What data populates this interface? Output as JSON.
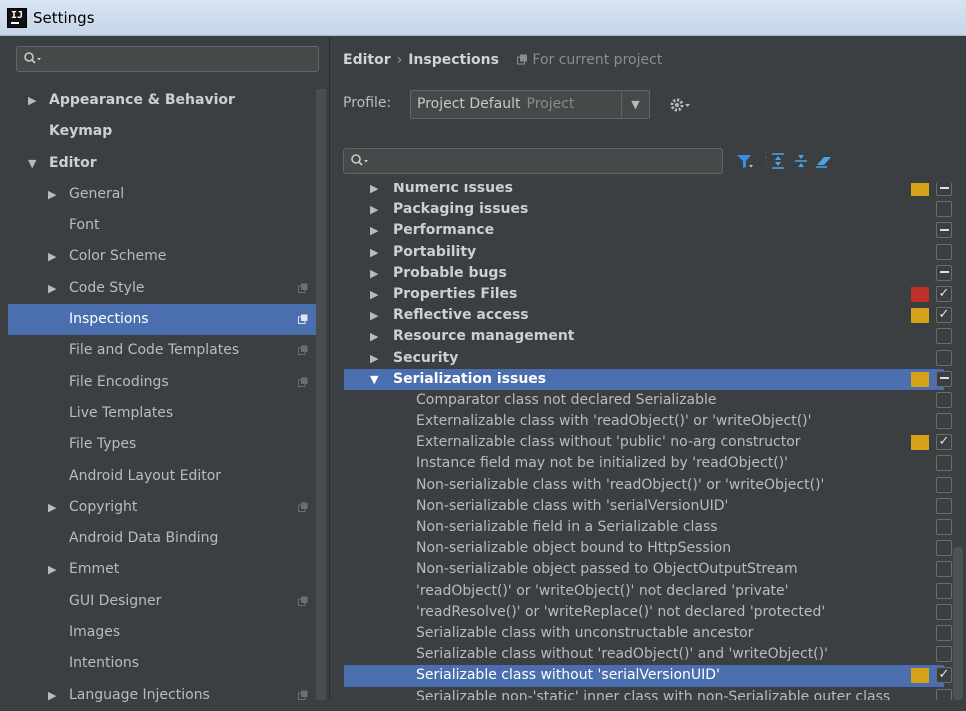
{
  "window": {
    "title": "Settings",
    "app_icon_text": "IJ"
  },
  "left_tree": [
    {
      "label": "Appearance & Behavior",
      "level": 0,
      "arrow": "right",
      "bold": true
    },
    {
      "label": "Keymap",
      "level": 0,
      "arrow": "",
      "bold": true
    },
    {
      "label": "Editor",
      "level": 0,
      "arrow": "down",
      "bold": true
    },
    {
      "label": "General",
      "level": 1,
      "arrow": "right"
    },
    {
      "label": "Font",
      "level": 1,
      "arrow": ""
    },
    {
      "label": "Color Scheme",
      "level": 1,
      "arrow": "right"
    },
    {
      "label": "Code Style",
      "level": 1,
      "arrow": "right",
      "copy": true
    },
    {
      "label": "Inspections",
      "level": 1,
      "arrow": "",
      "copy": true,
      "selected": true
    },
    {
      "label": "File and Code Templates",
      "level": 1,
      "arrow": "",
      "copy": true
    },
    {
      "label": "File Encodings",
      "level": 1,
      "arrow": "",
      "copy": true
    },
    {
      "label": "Live Templates",
      "level": 1,
      "arrow": ""
    },
    {
      "label": "File Types",
      "level": 1,
      "arrow": ""
    },
    {
      "label": "Android Layout Editor",
      "level": 1,
      "arrow": ""
    },
    {
      "label": "Copyright",
      "level": 1,
      "arrow": "right",
      "copy": true
    },
    {
      "label": "Android Data Binding",
      "level": 1,
      "arrow": ""
    },
    {
      "label": "Emmet",
      "level": 1,
      "arrow": "right"
    },
    {
      "label": "GUI Designer",
      "level": 1,
      "arrow": "",
      "copy": true
    },
    {
      "label": "Images",
      "level": 1,
      "arrow": ""
    },
    {
      "label": "Intentions",
      "level": 1,
      "arrow": ""
    },
    {
      "label": "Language Injections",
      "level": 1,
      "arrow": "right",
      "copy": true
    }
  ],
  "header": {
    "breadcrumb_root": "Editor",
    "breadcrumb_sep": "›",
    "breadcrumb_leaf": "Inspections",
    "scope_note": "For current project",
    "profile_label": "Profile:",
    "profile_value": "Project Default",
    "profile_scope": "Project"
  },
  "inspections": [
    {
      "label": "Numeric issues",
      "type": "group",
      "arrow": "right",
      "severity": "warning",
      "check": "partial"
    },
    {
      "label": "Packaging issues",
      "type": "group",
      "arrow": "right",
      "severity": "",
      "check": "none"
    },
    {
      "label": "Performance",
      "type": "group",
      "arrow": "right",
      "severity": "",
      "check": "partial"
    },
    {
      "label": "Portability",
      "type": "group",
      "arrow": "right",
      "severity": "",
      "check": "none"
    },
    {
      "label": "Probable bugs",
      "type": "group",
      "arrow": "right",
      "severity": "",
      "check": "partial"
    },
    {
      "label": "Properties Files",
      "type": "group",
      "arrow": "right",
      "severity": "error",
      "check": "checked"
    },
    {
      "label": "Reflective access",
      "type": "group",
      "arrow": "right",
      "severity": "warning",
      "check": "checked"
    },
    {
      "label": "Resource management",
      "type": "group",
      "arrow": "right",
      "severity": "",
      "check": "none"
    },
    {
      "label": "Security",
      "type": "group",
      "arrow": "right",
      "severity": "",
      "check": "none"
    },
    {
      "label": "Serialization issues",
      "type": "group",
      "arrow": "down",
      "severity": "warning",
      "check": "partial",
      "selected": true
    },
    {
      "label": "Comparator class not declared Serializable",
      "type": "item",
      "severity": "",
      "check": "none"
    },
    {
      "label": "Externalizable class with 'readObject()' or 'writeObject()'",
      "type": "item",
      "severity": "",
      "check": "none"
    },
    {
      "label": "Externalizable class without 'public' no-arg constructor",
      "type": "item",
      "severity": "warning",
      "check": "checked"
    },
    {
      "label": "Instance field may not be initialized by 'readObject()'",
      "type": "item",
      "severity": "",
      "check": "none"
    },
    {
      "label": "Non-serializable class with 'readObject()' or 'writeObject()'",
      "type": "item",
      "severity": "",
      "check": "none"
    },
    {
      "label": "Non-serializable class with 'serialVersionUID'",
      "type": "item",
      "severity": "",
      "check": "none"
    },
    {
      "label": "Non-serializable field in a Serializable class",
      "type": "item",
      "severity": "",
      "check": "none"
    },
    {
      "label": "Non-serializable object bound to HttpSession",
      "type": "item",
      "severity": "",
      "check": "none"
    },
    {
      "label": "Non-serializable object passed to ObjectOutputStream",
      "type": "item",
      "severity": "",
      "check": "none"
    },
    {
      "label": "'readObject()' or 'writeObject()' not declared 'private'",
      "type": "item",
      "severity": "",
      "check": "none"
    },
    {
      "label": "'readResolve()' or 'writeReplace()' not declared 'protected'",
      "type": "item",
      "severity": "",
      "check": "none"
    },
    {
      "label": "Serializable class with unconstructable ancestor",
      "type": "item",
      "severity": "",
      "check": "none"
    },
    {
      "label": "Serializable class without 'readObject()' and 'writeObject()'",
      "type": "item",
      "severity": "",
      "check": "none"
    },
    {
      "label": "Serializable class without 'serialVersionUID'",
      "type": "item",
      "severity": "warning",
      "check": "checked",
      "selected": true
    },
    {
      "label": "Serializable non-'static' inner class with non-Serializable outer class",
      "type": "item",
      "severity": "",
      "check": "none"
    }
  ],
  "colors": {
    "warning": "#d6a21a",
    "error": "#c0302b",
    "selection": "#4b6eaf",
    "filter_icon": "#3b8be8",
    "tool_icon": "#4aa3e8"
  }
}
